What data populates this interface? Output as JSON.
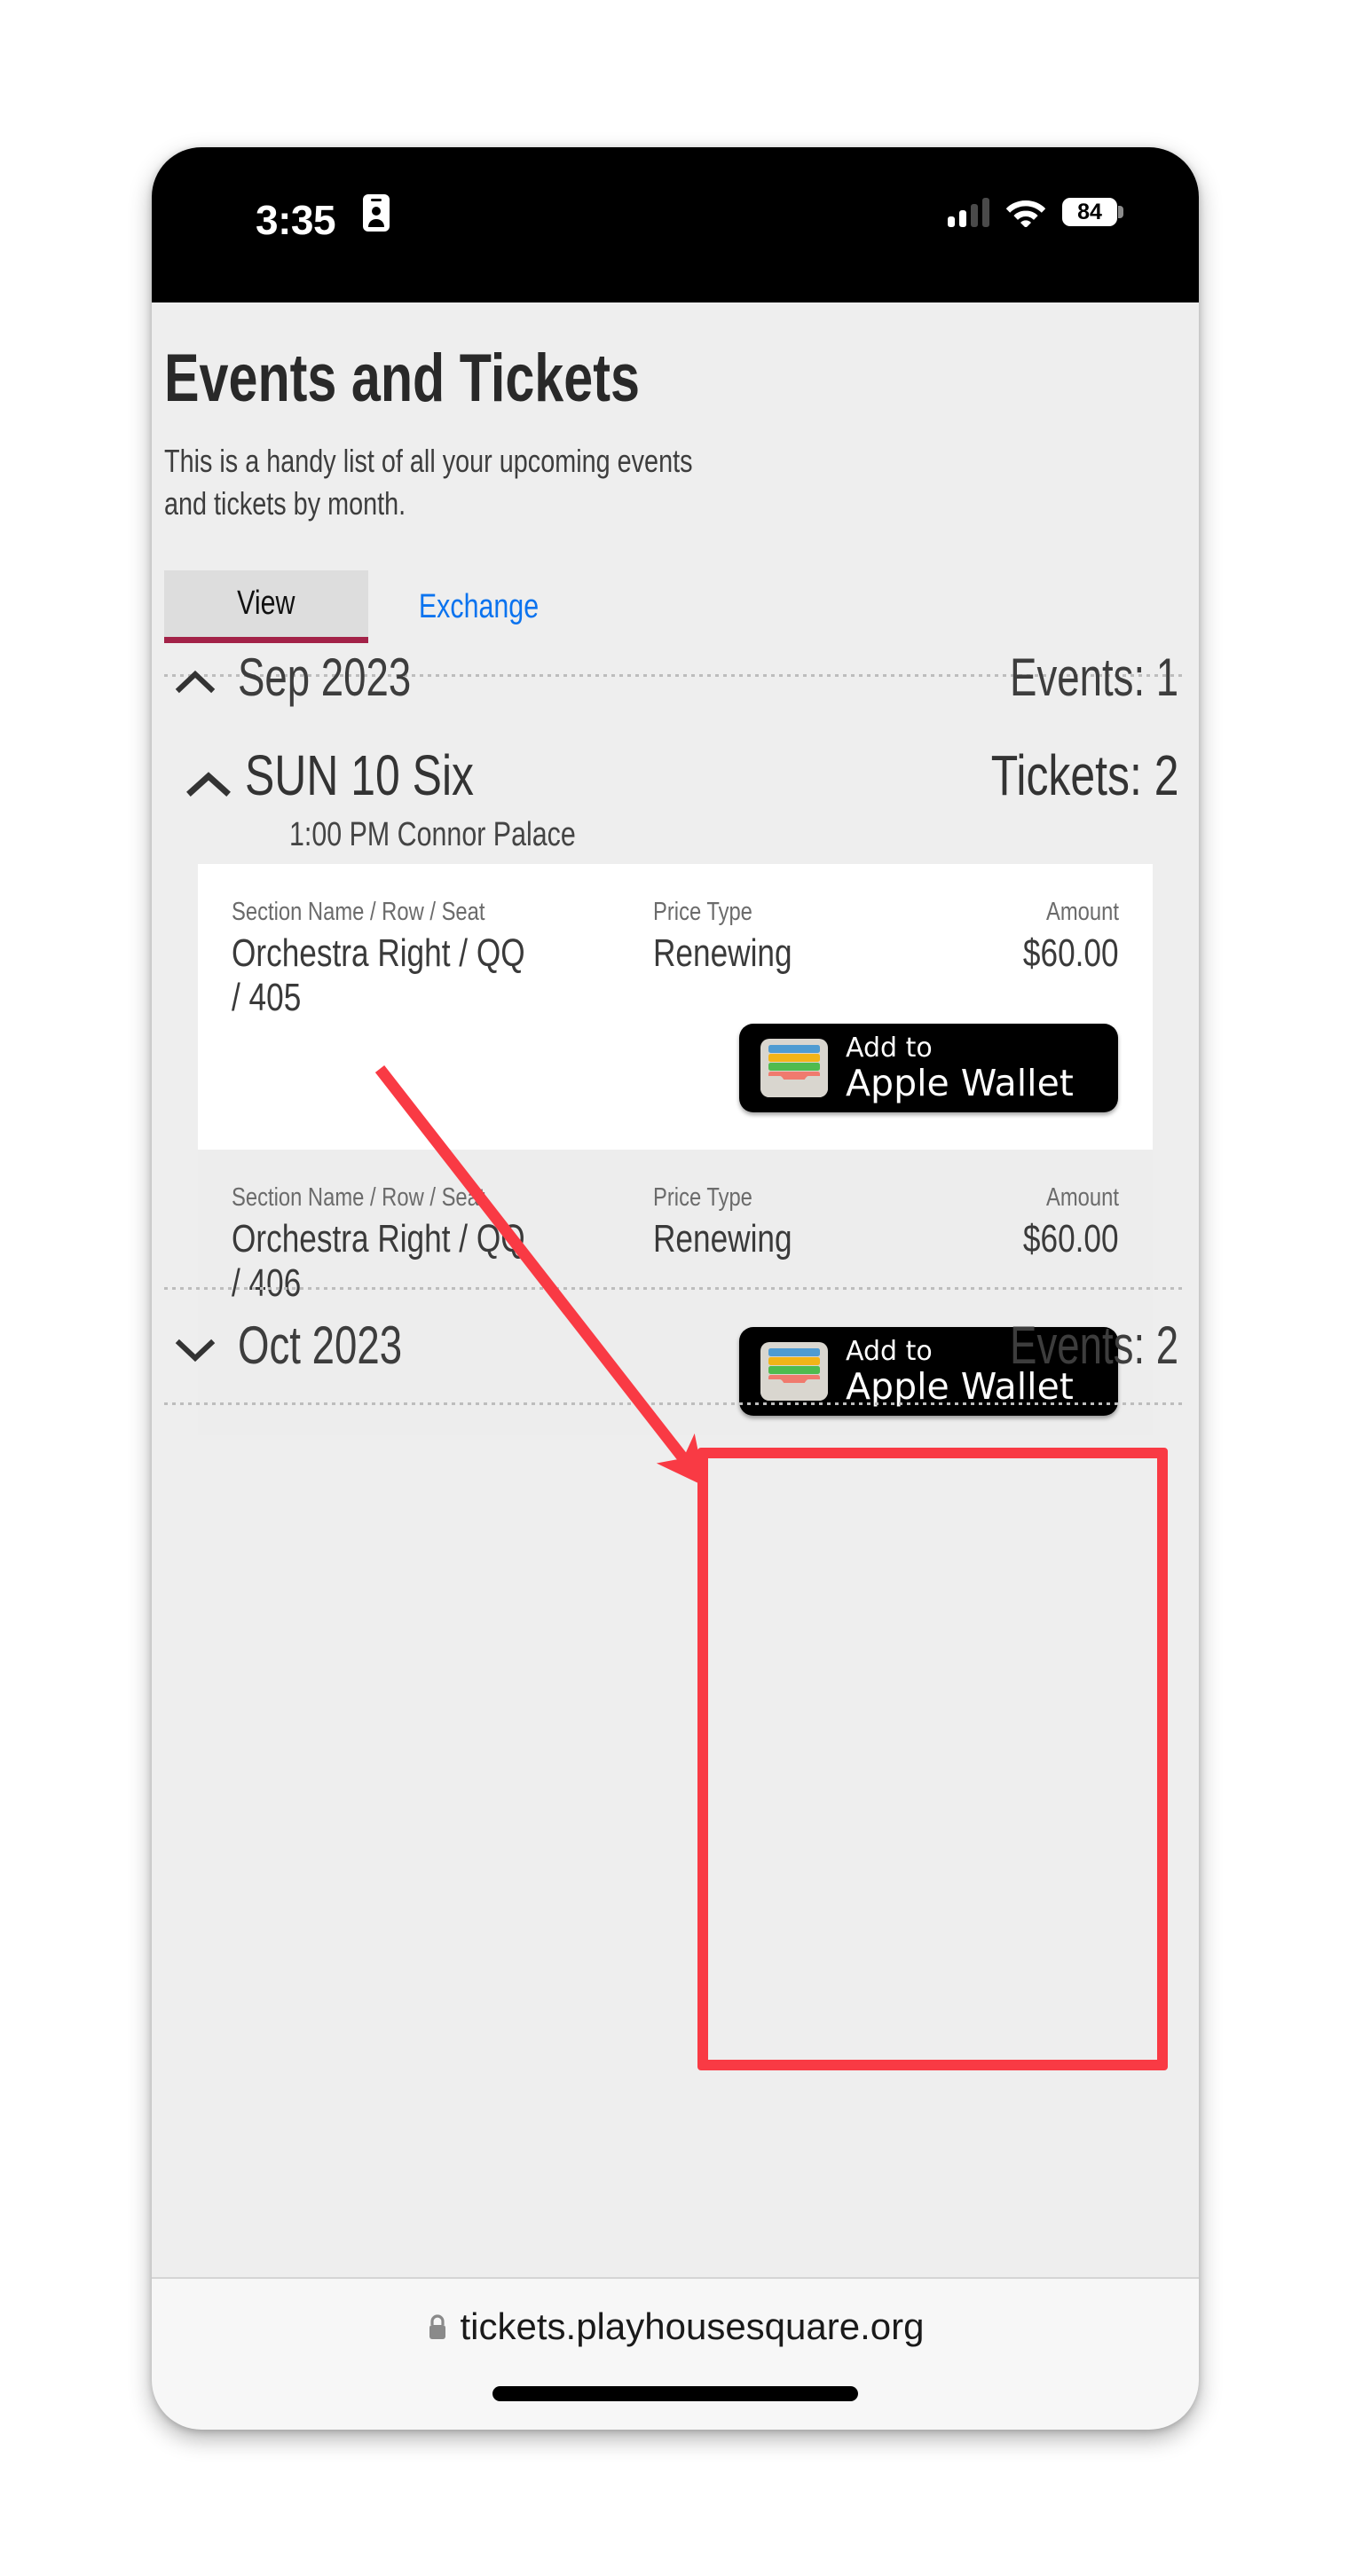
{
  "status_bar": {
    "time": "3:35",
    "id_icon": "id-card-icon",
    "cellular_icon": "cellular-signal-icon",
    "cellular_bars_filled": 2,
    "cellular_bars_total": 4,
    "wifi_icon": "wifi-icon",
    "battery_level": "84",
    "battery_icon": "battery-icon"
  },
  "header": {
    "title": "Events and Tickets",
    "subtitle": "This is a handy list of all your upcoming events and tickets by month."
  },
  "tabs": [
    {
      "label": "View",
      "active": true
    },
    {
      "label": "Exchange",
      "active": false
    }
  ],
  "months": [
    {
      "label": "Sep 2023",
      "count_label": "Events: 1",
      "expanded": true,
      "chevron": "chevron-up-icon"
    },
    {
      "label": "Oct 2023",
      "count_label": "Events: 2",
      "expanded": false,
      "chevron": "chevron-down-icon"
    }
  ],
  "event": {
    "chevron": "chevron-up-icon",
    "title": "SUN 10  Six",
    "tickets_label": "Tickets: 2",
    "time": "1:00 PM",
    "venue": "Connor Palace",
    "meta": "1:00 PM   Connor Palace"
  },
  "ticket_columns": {
    "seat": "Section Name / Row / Seat",
    "price_type": "Price Type",
    "amount": "Amount"
  },
  "tickets": [
    {
      "seat": "Orchestra Right / QQ / 405",
      "price_type": "Renewing",
      "amount": "$60.00",
      "wallet_line1": "Add to",
      "wallet_line2": "Apple Wallet"
    },
    {
      "seat": "Orchestra Right / QQ / 406",
      "price_type": "Renewing",
      "amount": "$60.00",
      "wallet_line1": "Add to",
      "wallet_line2": "Apple Wallet"
    }
  ],
  "browser": {
    "lock_icon": "lock-icon",
    "url": "tickets.playhousesquare.org"
  },
  "annotation": {
    "highlight_color": "#f93a44",
    "arrow_icon": "arrow-pointer-icon",
    "box_icon": "highlight-box"
  },
  "colors": {
    "accent_tab_underline": "#a32248",
    "link_blue": "#0b73ef",
    "annotation_red": "#f93a44",
    "page_bg": "#eeeeee",
    "card_white": "#ffffff"
  }
}
